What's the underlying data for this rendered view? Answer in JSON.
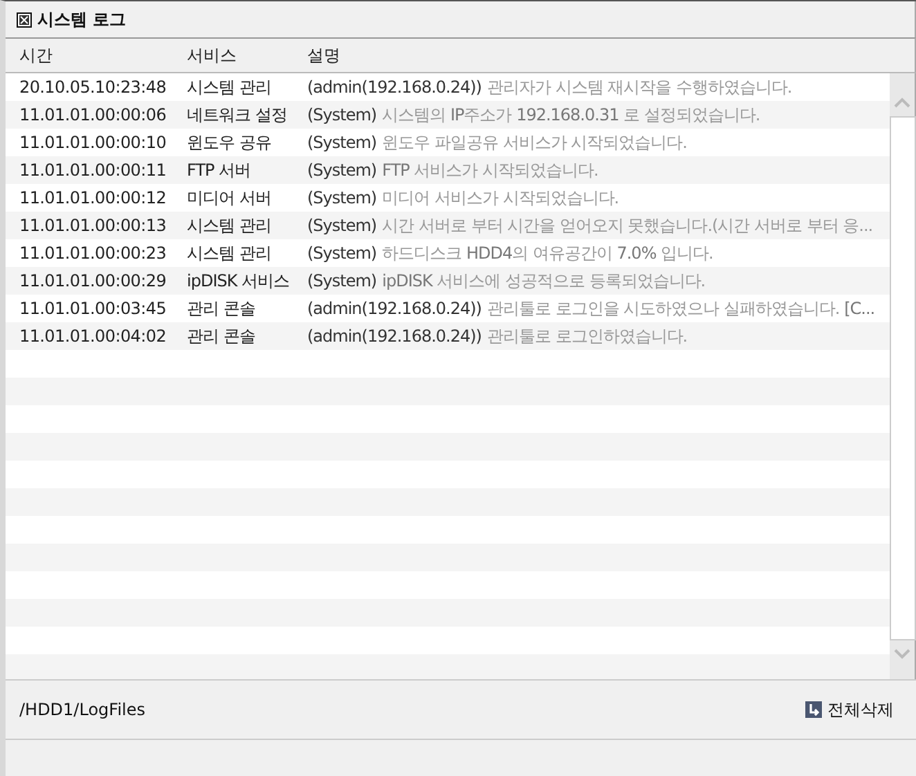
{
  "window": {
    "title": "시스템 로그"
  },
  "table": {
    "columns": [
      "시간",
      "서비스",
      "설명"
    ],
    "rows": [
      {
        "time": "20.10.05.10:23:48",
        "service": "시스템 관리",
        "source": "(admin(192.168.0.24))",
        "message": "관리자가 시스템 재시작을 수행하였습니다."
      },
      {
        "time": "11.01.01.00:00:06",
        "service": "네트워크 설정",
        "source": "(System)",
        "message": "시스템의 **IP**주소가 **192.168.0.31** 로 설정되었습니다."
      },
      {
        "time": "11.01.01.00:00:10",
        "service": "윈도우 공유",
        "source": "(System)",
        "message": "윈도우 파일공유 서비스가 시작되었습니다."
      },
      {
        "time": "11.01.01.00:00:11",
        "service": "FTP 서버",
        "source": "(System)",
        "message": "**FTP** 서비스가 시작되었습니다."
      },
      {
        "time": "11.01.01.00:00:12",
        "service": "미디어 서버",
        "source": "(System)",
        "message": "미디어 서비스가 시작되었습니다."
      },
      {
        "time": "11.01.01.00:00:13",
        "service": "시스템 관리",
        "source": "(System)",
        "message": "시간 서버로 부터 시간을 얻어오지 못했습니다.(시간 서버로 부터 응..."
      },
      {
        "time": "11.01.01.00:00:23",
        "service": "시스템 관리",
        "source": "(System)",
        "message": "하드디스크 **HDD4**의 여유공간이 **7.0%** 입니다."
      },
      {
        "time": "11.01.01.00:00:29",
        "service": "ipDISK 서비스",
        "source": "(System)",
        "message": "**ipDISK** 서비스에 성공적으로 등록되었습니다."
      },
      {
        "time": "11.01.01.00:03:45",
        "service": "관리 콘솔",
        "source": "(admin(192.168.0.24))",
        "message": "관리툴로 로그인을 시도하였으나 실패하였습니다. **[C...**"
      },
      {
        "time": "11.01.01.00:04:02",
        "service": "관리 콘솔",
        "source": "(admin(192.168.0.24))",
        "message": "관리툴로 로그인하였습니다."
      }
    ]
  },
  "footer": {
    "path": "/HDD1/LogFiles",
    "delete_all": "전체삭제"
  }
}
